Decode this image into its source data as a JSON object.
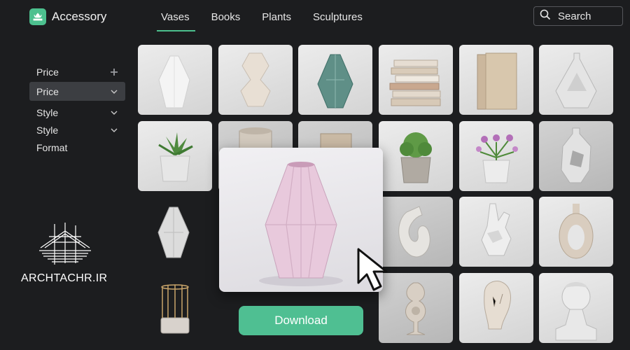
{
  "app": {
    "name": "Accessory",
    "logo_icon": "crown-leaf-icon",
    "accent_color": "#4cc08e"
  },
  "nav": {
    "tabs": [
      {
        "label": "Vases",
        "active": true
      },
      {
        "label": "Books",
        "active": false
      },
      {
        "label": "Plants",
        "active": false
      },
      {
        "label": "Sculptures",
        "active": false
      }
    ]
  },
  "search": {
    "label": "Search",
    "icon": "search-icon"
  },
  "filters": [
    {
      "label": "Price",
      "control": "plus-icon",
      "selected": false
    },
    {
      "label": "Price",
      "control": "chevron-down-icon",
      "selected": true
    },
    {
      "label": "Style",
      "control": "chevron-down-icon",
      "selected": false
    },
    {
      "label": "Style",
      "control": "chevron-down-icon",
      "selected": false
    },
    {
      "label": "Format",
      "control": "",
      "selected": false
    }
  ],
  "watermark": {
    "text": "ARCHTACHR.IR"
  },
  "grid": {
    "items": [
      "white-faceted-vase",
      "stacked-geometric-vase",
      "green-glass-vase",
      "stacked-books",
      "standing-books",
      "ring-geometric-vase",
      "succulent-pot",
      "cylinder-pot",
      "book",
      "leafy-plant-pot",
      "purple-flower-pot",
      "sculpted-open-vase",
      "faceted-white-vase",
      "gold-wire-planter",
      "abstract-knot-sculpture",
      "geometric-rabbit-head",
      "ring-vase",
      "twisted-knot-sculpture",
      "cracked-bust-sculpture",
      "classical-bust"
    ]
  },
  "preview": {
    "item": "pink-faceted-vase",
    "cursor_icon": "pointer-cursor-icon"
  },
  "download": {
    "label": "Download"
  }
}
